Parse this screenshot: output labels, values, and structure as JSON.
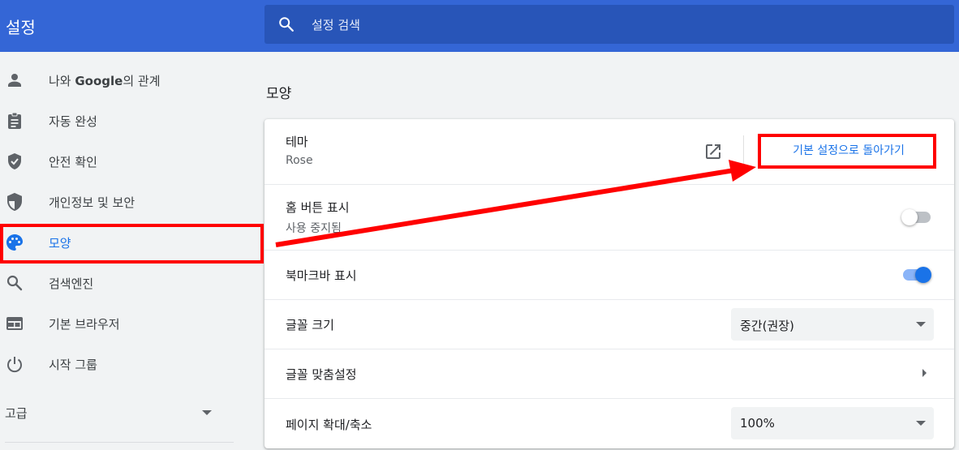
{
  "header": {
    "title": "설정",
    "search_placeholder": "설정 검색"
  },
  "sidebar": {
    "items": [
      {
        "label_pre": "나와 ",
        "label_bold": "Google",
        "label_post": "의 관계",
        "icon": "person-icon"
      },
      {
        "label": "자동 완성",
        "icon": "clipboard-icon"
      },
      {
        "label": "안전 확인",
        "icon": "shield-check-icon"
      },
      {
        "label": "개인정보 및 보안",
        "icon": "shield-half-icon"
      },
      {
        "label": "모양",
        "icon": "palette-icon",
        "active": true
      },
      {
        "label": "검색엔진",
        "icon": "search-icon"
      },
      {
        "label": "기본 브라우저",
        "icon": "browser-icon"
      },
      {
        "label": "시작 그룹",
        "icon": "power-icon"
      }
    ],
    "advanced_label": "고급"
  },
  "main": {
    "section_title": "모양",
    "theme": {
      "label": "테마",
      "value": "Rose",
      "reset_label": "기본 설정으로 돌아가기"
    },
    "home_button": {
      "label": "홈 버튼 표시",
      "status": "사용 중지됨",
      "enabled": false
    },
    "bookmarks_bar": {
      "label": "북마크바 표시",
      "enabled": true
    },
    "font_size": {
      "label": "글꼴 크기",
      "value": "중간(권장)"
    },
    "customize_fonts": {
      "label": "글꼴 맞춤설정"
    },
    "page_zoom": {
      "label": "페이지 확대/축소",
      "value": "100%"
    }
  },
  "colors": {
    "header_bg": "#3466d6",
    "search_bg": "#2855b8",
    "accent": "#1a73e8",
    "annotation": "#ff0000"
  }
}
